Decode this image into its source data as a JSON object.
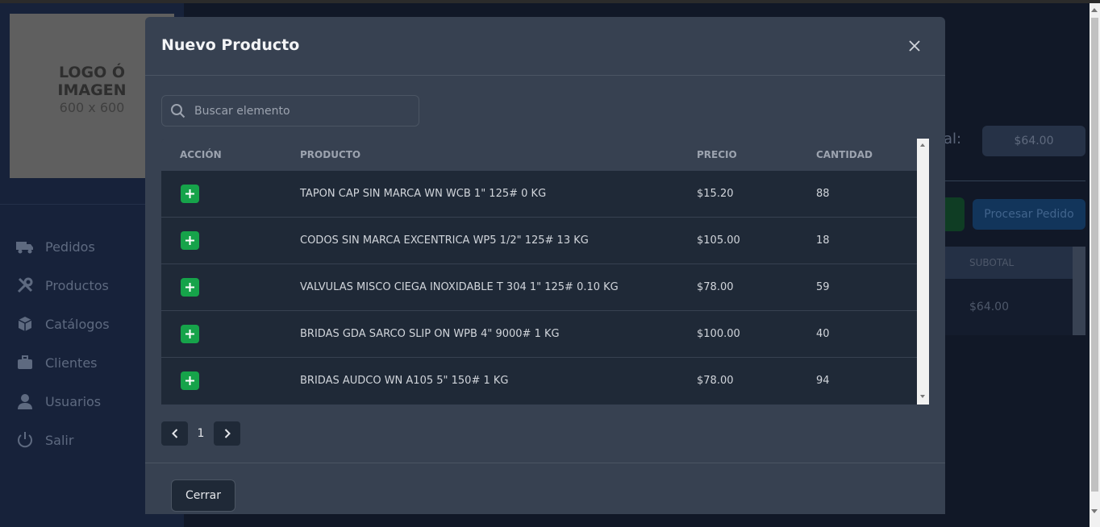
{
  "background": {
    "logo": {
      "line1": "LOGO Ó",
      "line2": "IMAGEN",
      "line3": "600 x 600"
    },
    "sidebar": {
      "items": [
        {
          "label": "Pedidos",
          "icon": "truck-icon"
        },
        {
          "label": "Productos",
          "icon": "tools-icon"
        },
        {
          "label": "Catálogos",
          "icon": "box-icon"
        },
        {
          "label": "Clientes",
          "icon": "briefcase-icon"
        },
        {
          "label": "Usuarios",
          "icon": "user-icon"
        },
        {
          "label": "Salir",
          "icon": "power-icon"
        }
      ]
    },
    "main": {
      "total_label_partial": "al:",
      "total_value": "$64.00",
      "process_button": "Procesar Pedido",
      "table_header": "SUBOTAL",
      "row_value": "$64.00"
    }
  },
  "modal": {
    "title": "Nuevo Producto",
    "search": {
      "placeholder": "Buscar elemento",
      "value": ""
    },
    "table": {
      "headers": {
        "action": "ACCIÓN",
        "product": "PRODUCTO",
        "price": "PRECIO",
        "quantity": "CANTIDAD"
      },
      "rows": [
        {
          "product": "TAPON CAP SIN MARCA WN WCB 1\" 125# 0 KG",
          "price": "$15.20",
          "quantity": "88"
        },
        {
          "product": "CODOS SIN MARCA EXCENTRICA WP5 1/2\" 125# 13 KG",
          "price": "$105.00",
          "quantity": "18"
        },
        {
          "product": "VALVULAS MISCO CIEGA INOXIDABLE T 304 1\" 125# 0.10 KG",
          "price": "$78.00",
          "quantity": "59"
        },
        {
          "product": "BRIDAS GDA SARCO SLIP ON WPB 4\" 9000# 1 KG",
          "price": "$100.00",
          "quantity": "40"
        },
        {
          "product": "BRIDAS AUDCO WN A105 5\" 150# 1 KG",
          "price": "$78.00",
          "quantity": "94"
        }
      ]
    },
    "pagination": {
      "current_page": "1"
    },
    "close_button": "Cerrar"
  },
  "colors": {
    "modal_bg": "#374151",
    "row_bg": "#1f2937",
    "add_button": "#16a34a",
    "page_bg": "#111827"
  }
}
